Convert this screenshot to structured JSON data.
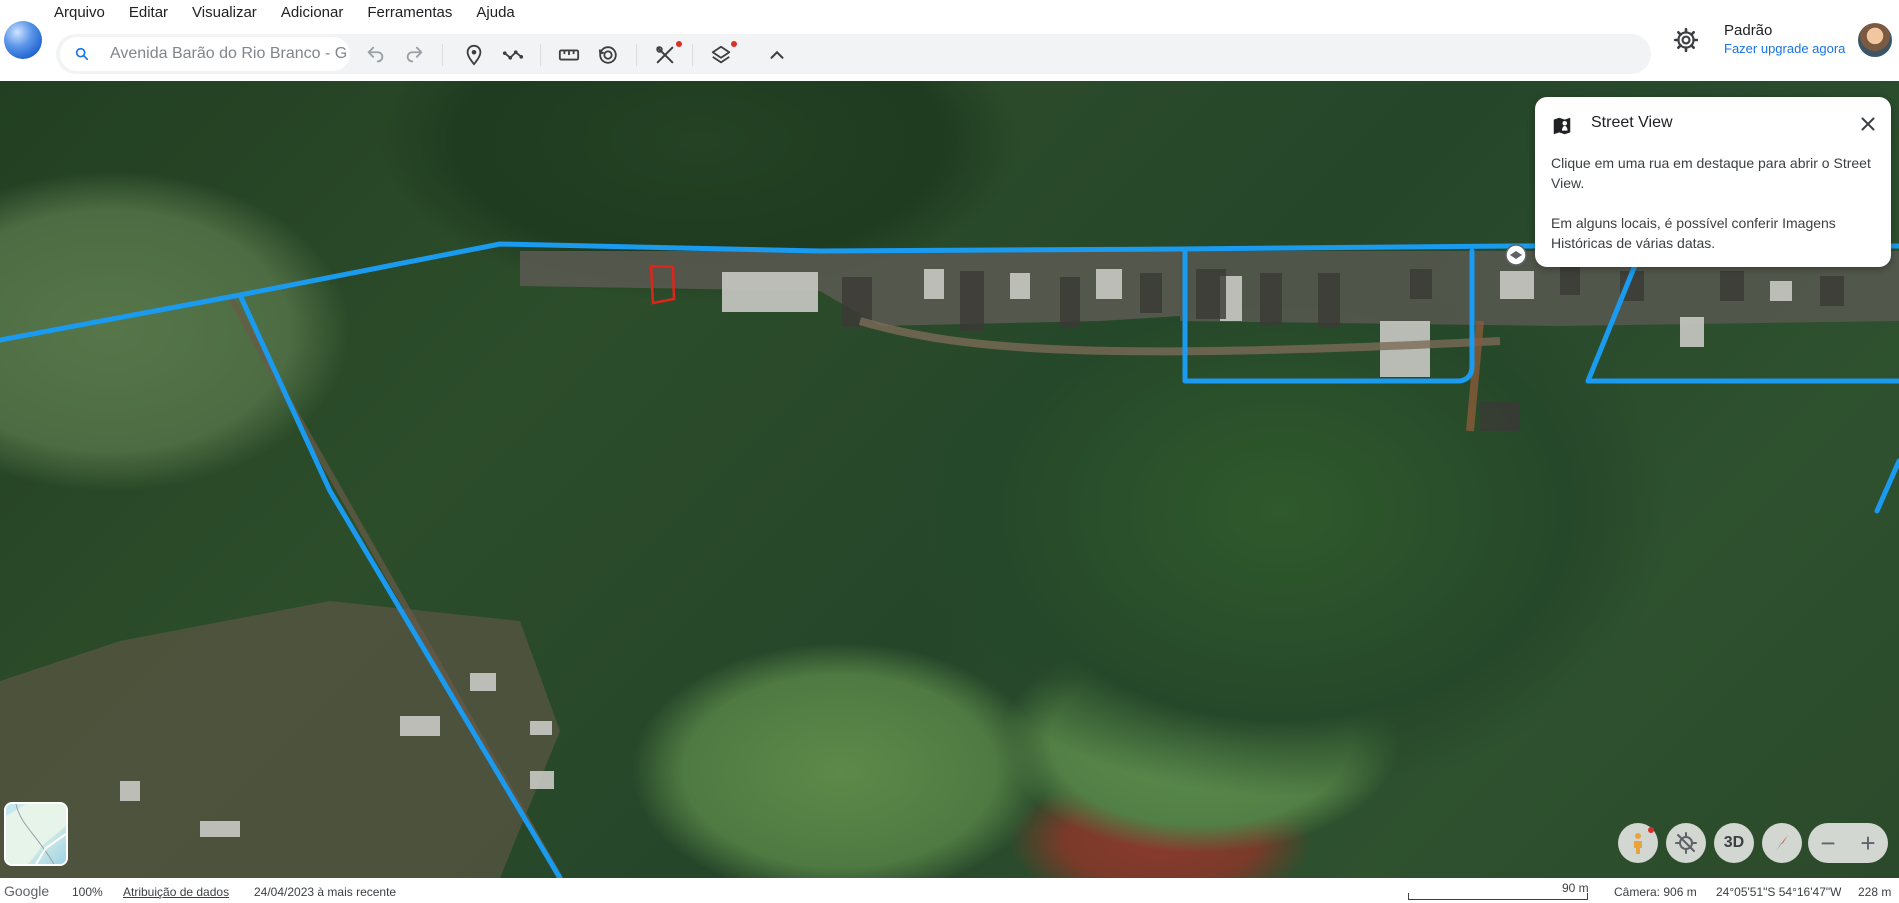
{
  "menu": [
    "Arquivo",
    "Editar",
    "Visualizar",
    "Adicionar",
    "Ferramentas",
    "Ajuda"
  ],
  "search": {
    "value": "Avenida Barão do Rio Branco - G"
  },
  "toolbar_icons": [
    "search-icon",
    "undo-icon",
    "redo-icon",
    "placemark-icon",
    "path-icon",
    "ruler-icon",
    "historical-imagery-icon",
    "tools-icon",
    "layers-icon",
    "chevron-up-icon"
  ],
  "profile": {
    "name": "Padrão",
    "upgrade_link": "Fazer upgrade agora"
  },
  "street_view_card": {
    "title": "Street View",
    "paragraph1": "Clique em uma rua em destaque para abrir o Street View.",
    "paragraph2": "Em alguns locais, é possível conferir Imagens Históricas de várias datas."
  },
  "controls": {
    "three_d_label": "3D",
    "zoom_out": "−",
    "zoom_in": "+"
  },
  "status": {
    "brand": "Google",
    "zoom": "100%",
    "attribution": "Atribuição de dados",
    "date": "24/04/2023 à mais recente",
    "scale": "90 m",
    "camera": "Câmera: 906 m",
    "coordinates": "24°05'51\"S 54°16'47\"W",
    "elevation": "228 m"
  },
  "colors": {
    "street_view_lines": "#1a9bf0",
    "accent": "#1a73e8",
    "alert_dot": "#d93025"
  }
}
